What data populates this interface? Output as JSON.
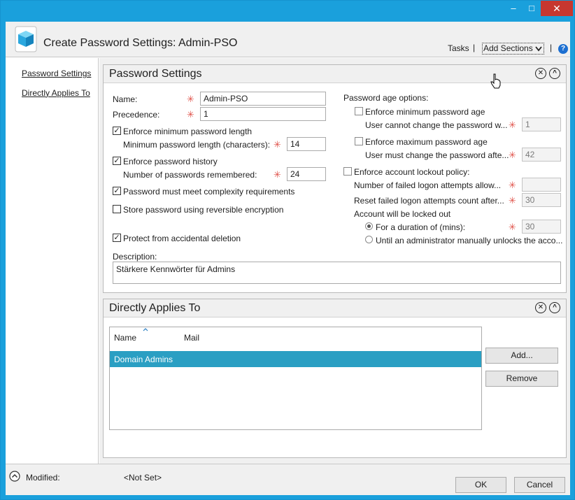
{
  "titlebar": {
    "minimize_glyph": "–",
    "maximize_glyph": "□",
    "close_glyph": "✕"
  },
  "header": {
    "title": "Create Password Settings: Admin-PSO",
    "tasks_label": "Tasks",
    "separator": "|",
    "add_sections_label": "Add Sections",
    "help_glyph": "?"
  },
  "nav": {
    "items": [
      {
        "label": "Password Settings"
      },
      {
        "label": "Directly Applies To"
      }
    ]
  },
  "password_settings": {
    "title": "Password Settings",
    "name_label": "Name:",
    "name_value": "Admin-PSO",
    "precedence_label": "Precedence:",
    "precedence_value": "1",
    "enforce_min_length_label": "Enforce minimum password length",
    "enforce_min_length_checked": true,
    "min_length_label": "Minimum password length (characters):",
    "min_length_value": "14",
    "enforce_history_label": "Enforce password history",
    "enforce_history_checked": true,
    "history_label": "Number of passwords remembered:",
    "history_value": "24",
    "complexity_label": "Password must meet complexity requirements",
    "complexity_checked": true,
    "reversible_label": "Store password using reversible encryption",
    "reversible_checked": false,
    "protect_label": "Protect from accidental deletion",
    "protect_checked": true,
    "age_options_label": "Password age options:",
    "enforce_min_age_label": "Enforce minimum password age",
    "min_age_label": "User cannot change the password w...",
    "min_age_value": "1",
    "enforce_max_age_label": "Enforce maximum password age",
    "max_age_label": "User must change the password afte...",
    "max_age_value": "42",
    "lockout_label": "Enforce account lockout policy:",
    "failed_attempts_label": "Number of failed logon attempts allow...",
    "failed_attempts_value": "",
    "reset_count_label": "Reset failed logon attempts count after...",
    "reset_count_value": "30",
    "locked_out_label": "Account will be locked out",
    "duration_label": "For a duration of (mins):",
    "duration_value": "30",
    "until_unlock_label": "Until an administrator manually unlocks the acco...",
    "description_label": "Description:",
    "description_value": "Stärkere Kennwörter für Admins",
    "required_mark": "✳"
  },
  "applies_to": {
    "title": "Directly Applies To",
    "columns": [
      "Name",
      "Mail"
    ],
    "rows": [
      {
        "name": "Domain Admins",
        "mail": ""
      }
    ],
    "add_label": "Add...",
    "remove_label": "Remove"
  },
  "footer": {
    "modified_label": "Modified:",
    "modified_value": "<Not Set>",
    "ok_label": "OK",
    "cancel_label": "Cancel"
  },
  "colors": {
    "title_bar": "#1aa0dc",
    "close_button": "#c7372f",
    "selection": "#2a9fc3",
    "required_mark": "#e0524a"
  }
}
